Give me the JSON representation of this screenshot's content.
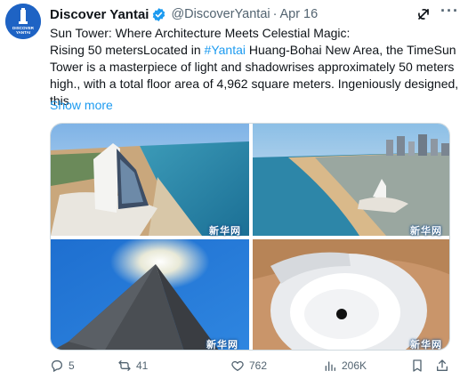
{
  "tweet": {
    "author_name": "Discover Yantai",
    "handle": "@DiscoverYantai",
    "separator": "·",
    "date": "Apr 16",
    "avatar_text": "DISCOVER YANTAI",
    "text_lines": [
      "Sun Tower: Where Architecture Meets Celestial Magic:",
      "Rising 50 metersLocated in ",
      "Tower is a masterpiece of light and shadowrises approximately 50 meters",
      "high., with a total floor area of 4,962 square meters. Ingeniously designed,",
      "this"
    ],
    "hashtag": "#Yantai",
    "line2_suffix": " Huang-Bohai New Area, the TimeSun",
    "show_more": "Show more",
    "watermark": "新华网",
    "icons": {
      "verified": "verified-badge-icon",
      "grok": "grok-icon",
      "more": "more-options-icon"
    },
    "colors": {
      "link": "#1d9bf0",
      "secondary_text": "#536471",
      "verified": "#1d9bf0",
      "avatar_bg": "#1e63c4"
    }
  },
  "actions": {
    "reply_count": "5",
    "retweet_count": "41",
    "like_count": "762",
    "views_count": "206K"
  }
}
